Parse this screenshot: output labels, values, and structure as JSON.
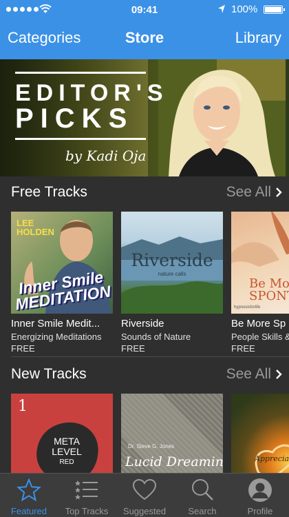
{
  "status": {
    "time": "09:41",
    "battery": "100%"
  },
  "nav": {
    "left": "Categories",
    "title": "Store",
    "right": "Library"
  },
  "banner": {
    "line1": "EDITOR'S",
    "line2": "PICKS",
    "byline": "by Kadi Oja"
  },
  "free": {
    "title": "Free Tracks",
    "see_all": "See All",
    "items": [
      {
        "name": "Inner Smile Medit...",
        "sub": "Energizing Meditations",
        "price": "FREE",
        "art_text": "Inner Smile MEDITATION",
        "art_top": "LEE HOLDEN"
      },
      {
        "name": "Riverside",
        "sub": "Sounds of Nature",
        "price": "FREE",
        "art_text": "Riverside",
        "art_top": "nature calls"
      },
      {
        "name": "Be More Sp",
        "sub": "People Skills &",
        "price": "FREE",
        "art_text": "Be More SPONTAN",
        "art_top": "hypnosisforlife"
      }
    ]
  },
  "new": {
    "title": "New Tracks",
    "see_all": "See All",
    "items": [
      {
        "art_num": "1",
        "art_text": "META LEVEL",
        "art_sub": "RED"
      },
      {
        "art_text": "Lucid Dreaming",
        "art_top": "Dr. Steve G. Jones"
      },
      {
        "art_text": "Appreciat"
      }
    ]
  },
  "tabs": [
    {
      "label": "Featured",
      "icon": "star-icon",
      "active": true
    },
    {
      "label": "Top Tracks",
      "icon": "list-icon",
      "active": false
    },
    {
      "label": "Suggested",
      "icon": "heart-icon",
      "active": false
    },
    {
      "label": "Search",
      "icon": "search-icon",
      "active": false
    },
    {
      "label": "Profile",
      "icon": "profile-icon",
      "active": false
    }
  ],
  "colors": {
    "accent": "#3b91e6",
    "background": "#2f2f2f",
    "tabbar": "#3c3c3c"
  }
}
